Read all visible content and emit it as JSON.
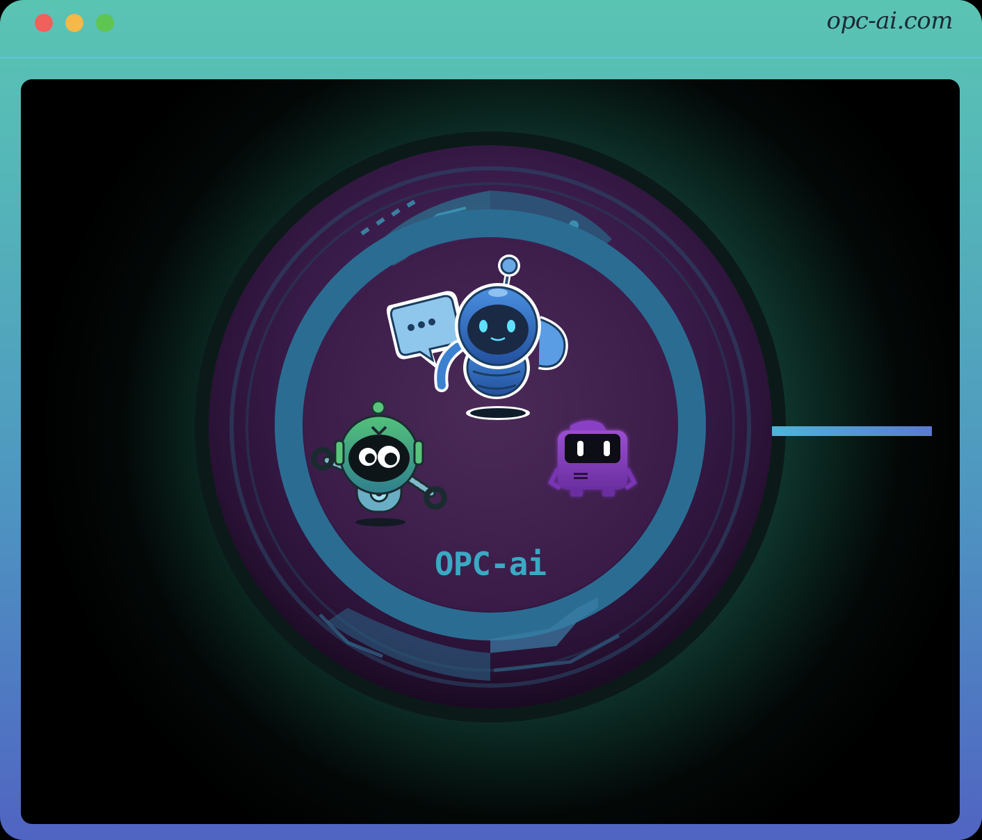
{
  "window": {
    "site_title": "opc-ai.com",
    "controls": {
      "close": "close-dot",
      "minimize": "minimize-dot",
      "maximize": "maximize-dot"
    }
  },
  "logo": {
    "text": "OPC-ai",
    "mascots": [
      "blue-chat-robot",
      "green-wrench-robot",
      "purple-box-robot"
    ]
  },
  "colors": {
    "frame_top": "#5ac4b3",
    "frame_bottom": "#5064c2",
    "logo_text": "#3aa9c4",
    "disc_inner": "#3b1d4c",
    "ring": "#2c6b8f",
    "accent_bar": "#4fb6d8"
  }
}
